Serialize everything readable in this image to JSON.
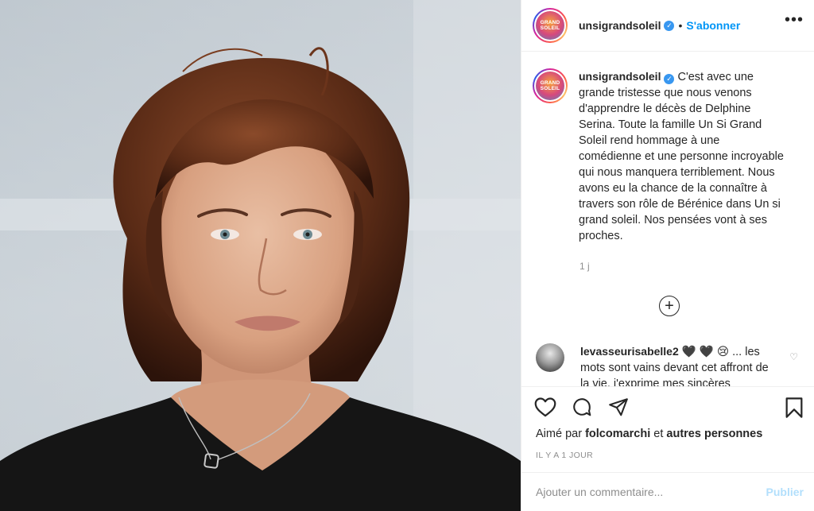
{
  "photo": {
    "alt": ""
  },
  "header": {
    "avatar_logo_lines": [
      "GRAND",
      "SOLEIL"
    ],
    "username": "unsigrandsoleil",
    "verified_mark": "✓",
    "separator": "•",
    "follow_label": "S'abonner",
    "more_label": "•••"
  },
  "caption": {
    "username": "unsigrandsoleil",
    "text": "C'est avec une grande tristesse que nous venons d'apprendre le décès de Delphine Serina. Toute la famille Un Si Grand Soleil rend hommage à une comédienne et une personne incroyable qui nous manquera terriblement. Nous avons eu la chance de la connaître à travers son rôle de Bérénice dans Un si grand soleil. Nos pensées vont à ses proches.",
    "time": "1 j"
  },
  "load_more": {
    "icon": "plus-circle-icon",
    "label": "+"
  },
  "comment": {
    "username": "levasseurisabelle2",
    "text": "🖤 🖤 😢 ... les mots sont vains devant cet affront de la vie, j'exprime mes sincères",
    "like_icon": "heart-icon",
    "like_glyph": "♡"
  },
  "actions": {
    "like_icon": "heart-icon",
    "comment_icon": "comment-icon",
    "share_icon": "share-icon",
    "save_icon": "bookmark-icon",
    "liked_by_prefix": "Aimé par",
    "liked_by_user": "folcomarchi",
    "liked_by_and": "et",
    "liked_by_others": "autres personnes",
    "timestamp": "IL Y A 1 JOUR"
  },
  "add_comment": {
    "placeholder": "Ajouter un commentaire...",
    "publish_label": "Publier"
  },
  "colors": {
    "link_blue": "#0095f6",
    "publish_disabled": "#b2dffc",
    "text": "#262626",
    "muted": "#8e8e8e",
    "divider": "#efefef"
  }
}
